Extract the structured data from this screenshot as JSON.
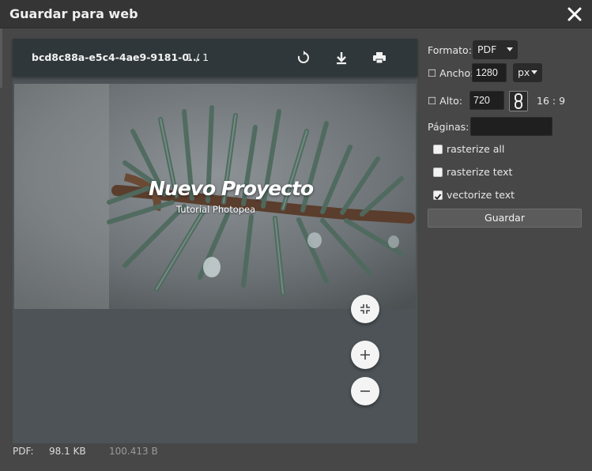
{
  "dialog": {
    "title": "Guardar para web"
  },
  "viewer": {
    "doc_name": "bcd8c88a-e5c4-4ae9-9181-0...",
    "page_count": "1 / 1",
    "icons": {
      "rotate": "rotate-icon",
      "download": "download-icon",
      "print": "print-icon",
      "fit": "fit-page-icon",
      "zoom_in": "zoom-in-icon",
      "zoom_out": "zoom-out-icon"
    }
  },
  "document": {
    "title": "Nuevo Proyecto",
    "subtitle": "Tutorial Photopea"
  },
  "settings": {
    "format_label": "Formato:",
    "format_value": "PDF",
    "width_label": "☐ Ancho:",
    "width_value": "1280",
    "unit_value": "px",
    "height_label": "☐ Alto:",
    "height_value": "720",
    "ratio": "16 : 9",
    "pages_label": "Páginas:",
    "pages_value": "",
    "options": [
      {
        "label": "rasterize all",
        "checked": false
      },
      {
        "label": "rasterize text",
        "checked": false
      },
      {
        "label": "vectorize text",
        "checked": true
      }
    ],
    "save_label": "Guardar"
  },
  "footer": {
    "format": "PDF:",
    "size": "98.1 KB",
    "bytes": "100.413 B"
  },
  "colors": {
    "toolbar": "#30373a",
    "viewer_bg": "#4d5357",
    "panel_bg": "#474747",
    "titlebar": "#353535"
  }
}
